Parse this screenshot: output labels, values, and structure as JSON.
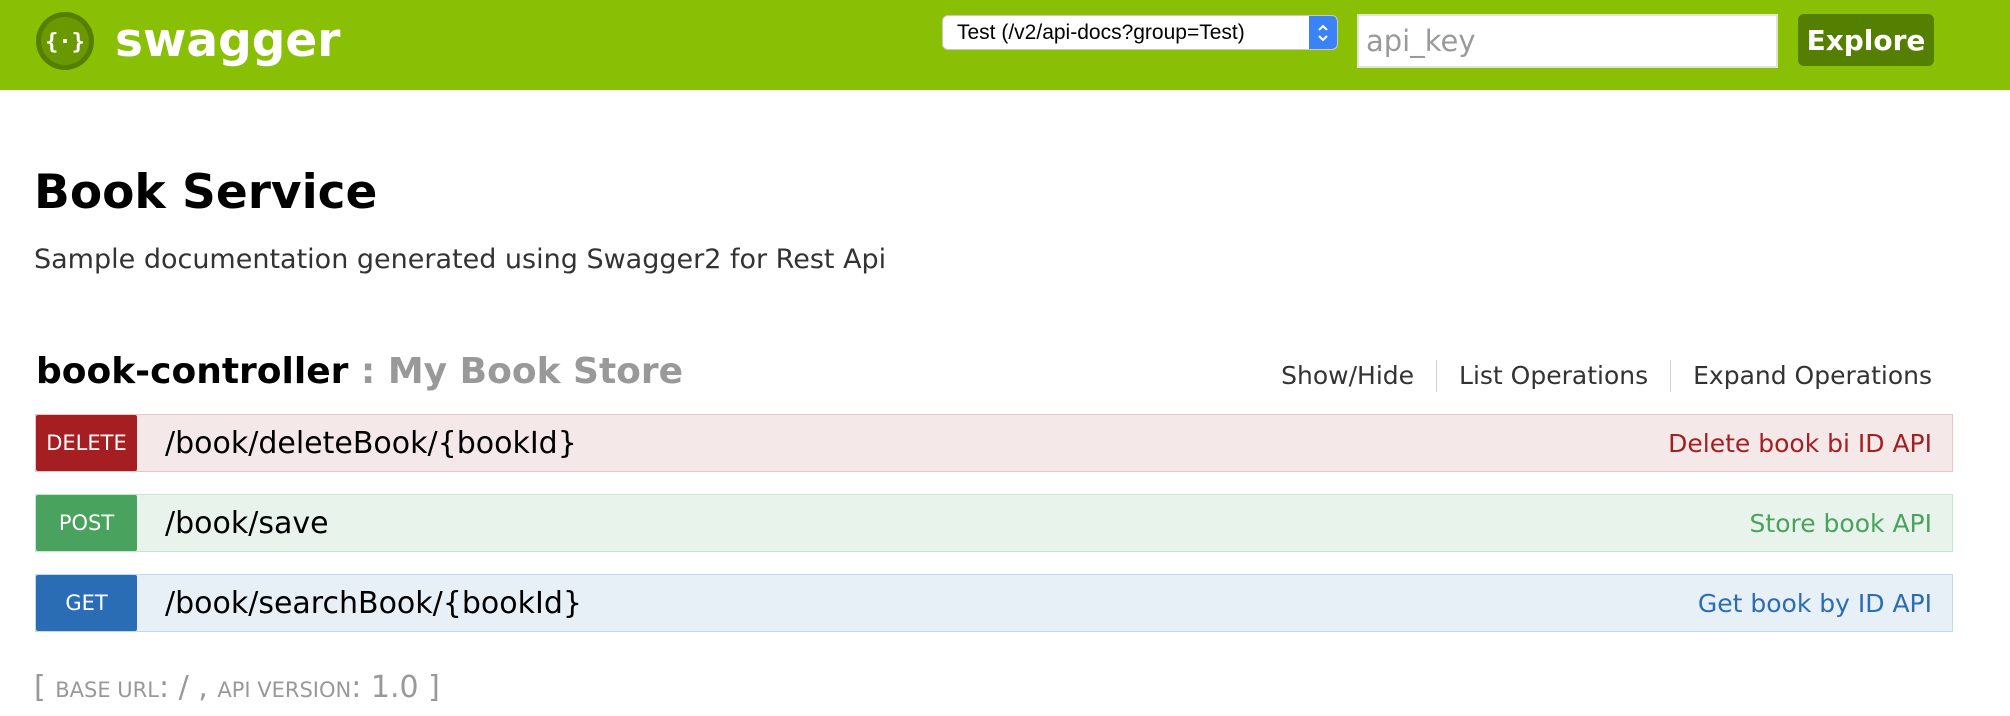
{
  "header": {
    "logo_text": "swagger",
    "select_value": "Test (/v2/api-docs?group=Test)",
    "api_key_placeholder": "api_key",
    "explore_label": "Explore"
  },
  "info": {
    "title": "Book Service",
    "description": "Sample documentation generated using Swagger2 for Rest Api"
  },
  "resource": {
    "name": "book-controller",
    "separator": " : ",
    "description": "My Book Store",
    "links": {
      "show_hide": "Show/Hide",
      "list_operations": "List Operations",
      "expand_operations": "Expand Operations"
    }
  },
  "operations": [
    {
      "method": "DELETE",
      "path": "/book/deleteBook/{bookId}",
      "summary": "Delete book bi ID API"
    },
    {
      "method": "POST",
      "path": "/book/save",
      "summary": "Store book API"
    },
    {
      "method": "GET",
      "path": "/book/searchBook/{bookId}",
      "summary": "Get book by ID API"
    }
  ],
  "footer": {
    "open_bracket": "[ ",
    "base_url_label": "BASE URL",
    "colon1": ": ",
    "base_url_value": "/",
    "comma": " , ",
    "api_version_label": "API VERSION",
    "colon2": ": ",
    "api_version_value": "1.0",
    "close_bracket": " ]"
  },
  "colors": {
    "header_bg": "#89bf04",
    "explore_bg": "#547f00",
    "delete": "#a41e22",
    "post": "#49a35e",
    "get": "#2b6db5"
  },
  "icons": {
    "logo": "swagger-braces-logo-icon",
    "select_arrows": "chevron-up-down-icon"
  }
}
